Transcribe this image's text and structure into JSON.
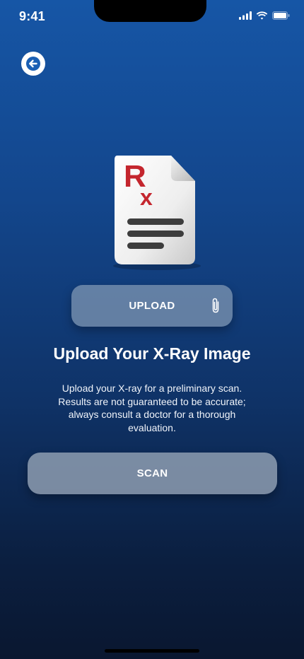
{
  "status_bar": {
    "time": "9:41",
    "icons": [
      "signal-icon",
      "wifi-icon",
      "battery-icon"
    ]
  },
  "navigation": {
    "back_icon": "arrow-left-icon"
  },
  "illustration": {
    "icon": "rx-prescription-document-icon",
    "rx_label": "Rx",
    "rx_color": "#c4262e"
  },
  "upload": {
    "label": "UPLOAD",
    "icon": "paperclip-icon"
  },
  "content": {
    "title": "Upload Your X-Ray Image",
    "description_lines": [
      "Upload your X-ray for a preliminary scan.",
      "Results are not guaranteed to be accurate;",
      "always consult a doctor for a thorough",
      "evaluation."
    ]
  },
  "scan": {
    "label": "SCAN"
  },
  "colors": {
    "background_top": "#1656a6",
    "background_bottom": "#0a1730",
    "accent": "#1a5fb4"
  }
}
